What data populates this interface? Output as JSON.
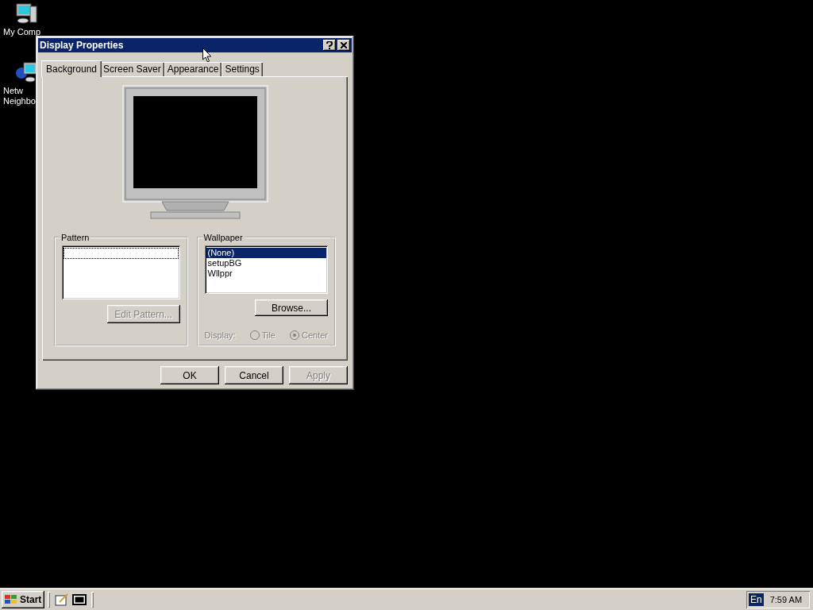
{
  "desktop_icons": [
    {
      "kind": "computer",
      "lines": [
        "My Comp"
      ]
    },
    {
      "kind": "network",
      "lines": [
        "Netw",
        "Neighbo"
      ]
    }
  ],
  "window": {
    "title": "Display Properties",
    "tabs": [
      {
        "label": "Background",
        "selected": true
      },
      {
        "label": "Screen Saver",
        "selected": false
      },
      {
        "label": "Appearance",
        "selected": false
      },
      {
        "label": "Settings",
        "selected": false
      }
    ],
    "pattern": {
      "title": "Pattern",
      "edit_button": {
        "label": "Edit Pattern...",
        "disabled": true
      }
    },
    "wallpaper": {
      "title": "Wallpaper",
      "items": [
        {
          "label": "(None)",
          "selected": true
        },
        {
          "label": "setupBG",
          "selected": false
        },
        {
          "label": "Wllppr",
          "selected": false
        }
      ],
      "browse_button": {
        "label": "Browse...",
        "disabled": false
      },
      "display_label": "Display:",
      "display_disabled": true,
      "options": [
        {
          "label": "Tile",
          "selected": false
        },
        {
          "label": "Center",
          "selected": true
        }
      ]
    },
    "buttons": [
      {
        "label": "OK",
        "disabled": false
      },
      {
        "label": "Cancel",
        "disabled": false
      },
      {
        "label": "Apply",
        "disabled": true
      }
    ]
  },
  "taskbar": {
    "start_label": "Start",
    "tray_language": "En",
    "clock": "7:59 AM"
  }
}
